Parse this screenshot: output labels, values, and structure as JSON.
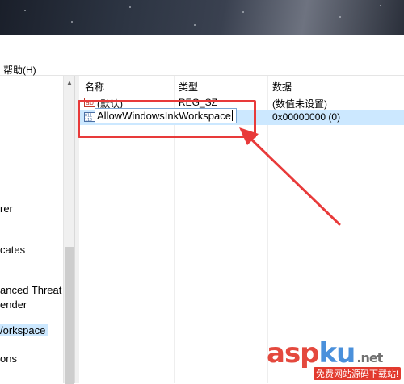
{
  "menubar": {
    "help_label": "帮助(H)"
  },
  "tree": {
    "items": [
      {
        "label": "rer",
        "selected": false
      },
      {
        "label": "cates",
        "selected": false
      },
      {
        "label": "anced Threat P",
        "selected": false
      },
      {
        "label": "ender",
        "selected": false
      },
      {
        "label": "/orkspace",
        "selected": true
      },
      {
        "label": "ons",
        "selected": false
      }
    ]
  },
  "list": {
    "columns": {
      "name": "名称",
      "type": "类型",
      "data": "数据"
    },
    "rows": [
      {
        "name": "(默认)",
        "type": "REG_SZ",
        "data": "(数值未设置)",
        "icon": "string-value-icon"
      },
      {
        "name": "AllowWindowsInkWorkspace",
        "type": "",
        "data": "0x00000000 (0)",
        "icon": "dword-value-icon",
        "editing": true
      }
    ]
  },
  "annotation": {
    "color": "#e83a3a"
  },
  "watermark": {
    "asp": "asp",
    "ku": "ku",
    "net": ".net",
    "sub": "免费网站源码下载站!"
  },
  "colors": {
    "selection": "#cce8ff",
    "annotation_red": "#e83a3a",
    "brand_red": "#e23a2e",
    "brand_blue": "#3b87d8"
  }
}
